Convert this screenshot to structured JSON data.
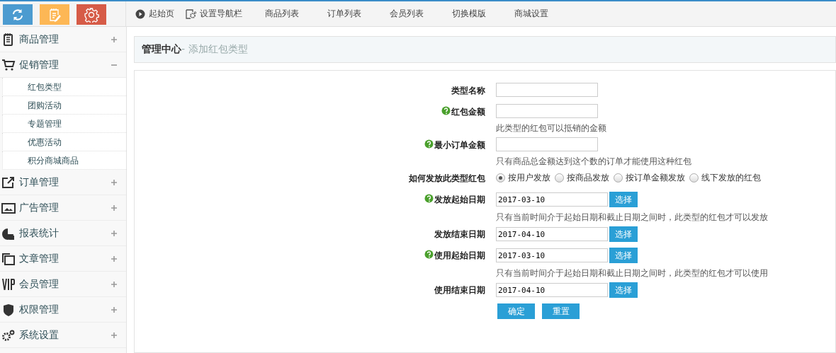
{
  "nav": [
    {
      "label": "起始页"
    },
    {
      "label": "设置导航栏"
    },
    {
      "label": "商品列表"
    },
    {
      "label": "订单列表"
    },
    {
      "label": "会员列表"
    },
    {
      "label": "切换模版"
    },
    {
      "label": "商城设置"
    }
  ],
  "sidebar": {
    "sections": [
      {
        "label": "商品管理",
        "expanded": false
      },
      {
        "label": "促销管理",
        "expanded": true,
        "children": [
          {
            "label": "红包类型"
          },
          {
            "label": "团购活动"
          },
          {
            "label": "专题管理"
          },
          {
            "label": "优惠活动"
          },
          {
            "label": "积分商城商品"
          }
        ]
      },
      {
        "label": "订单管理",
        "expanded": false
      },
      {
        "label": "广告管理",
        "expanded": false
      },
      {
        "label": "报表统计",
        "expanded": false
      },
      {
        "label": "文章管理",
        "expanded": false
      },
      {
        "label": "会员管理",
        "expanded": false
      },
      {
        "label": "权限管理",
        "expanded": false
      },
      {
        "label": "系统设置",
        "expanded": false
      }
    ]
  },
  "breadcrumb": {
    "root": "管理中心",
    "current": "- 添加红包类型"
  },
  "form": {
    "fields": [
      {
        "kind": "text",
        "label": "类型名称",
        "help": false
      },
      {
        "kind": "text",
        "label": "红包金额",
        "help": true,
        "hint": "此类型的红包可以抵销的金额"
      },
      {
        "kind": "text",
        "label": "最小订单金额",
        "help": true,
        "hint": "只有商品总金额达到这个数的订单才能使用这种红包"
      },
      {
        "kind": "radio",
        "label": "如何发放此类型红包",
        "options": [
          {
            "label": "按用户发放",
            "selected": true
          },
          {
            "label": "按商品发放",
            "selected": false
          },
          {
            "label": "按订单金额发放",
            "selected": false
          },
          {
            "label": "线下发放的红包",
            "selected": false
          }
        ]
      },
      {
        "kind": "date",
        "label": "发放起始日期",
        "help": true,
        "value": "2017-03-10",
        "button": "选择",
        "hint": "只有当前时间介于起始日期和截止日期之间时，此类型的红包才可以发放"
      },
      {
        "kind": "date",
        "label": "发放结束日期",
        "help": false,
        "value": "2017-04-10",
        "button": "选择"
      },
      {
        "kind": "date",
        "label": "使用起始日期",
        "help": true,
        "value": "2017-03-10",
        "button": "选择",
        "hint": "只有当前时间介于起始日期和截止日期之间时，此类型的红包才可以使用"
      },
      {
        "kind": "date",
        "label": "使用结束日期",
        "help": false,
        "value": "2017-04-10",
        "button": "选择"
      }
    ],
    "buttons": [
      "确定",
      "重置"
    ]
  }
}
